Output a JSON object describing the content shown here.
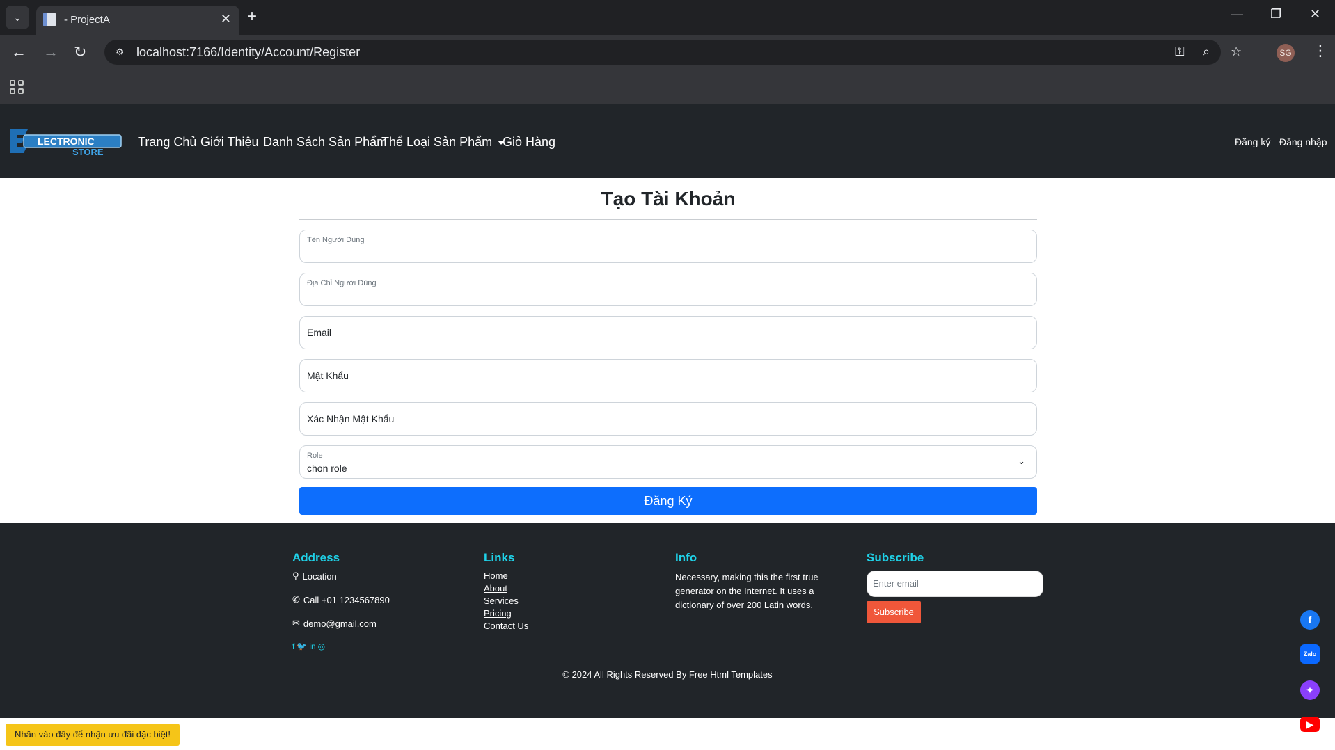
{
  "browser": {
    "tab_title": "- ProjectA",
    "url": "localhost:7166/Identity/Account/Register",
    "profile_initials": "SG"
  },
  "navbar": {
    "logo_text_top": "LECTRONIC",
    "logo_text_bottom": "STORE",
    "links": [
      "Trang Chủ",
      "Giới Thiệu",
      "Danh Sách Sản Phẩm",
      "Thể Loại Sản Phẩm",
      "Giỏ Hàng"
    ],
    "register": "Đăng ký",
    "login": "Đăng nhập"
  },
  "form": {
    "title": "Tạo Tài Khoản",
    "username_label": "Tên Người Dùng",
    "address_label": "Địa Chỉ Người Dùng",
    "email_label": "Email",
    "password_label": "Mật Khẩu",
    "confirm_label": "Xác Nhận Mật Khẩu",
    "role_label": "Role",
    "role_value": "chon role",
    "submit": "Đăng Ký"
  },
  "footer": {
    "address_head": "Address",
    "location": "Location",
    "phone": "Call +01 1234567890",
    "email": "demo@gmail.com",
    "links_head": "Links",
    "links": [
      "Home",
      "About",
      "Services",
      "Pricing",
      "Contact Us"
    ],
    "info_head": "Info",
    "info_text": "Necessary, making this the first true generator on the Internet. It uses a dictionary of over 200 Latin words.",
    "subscribe_head": "Subscribe",
    "subscribe_placeholder": "Enter email",
    "subscribe_button": "Subscribe",
    "copyright": "© 2024 All Rights Reserved By Free Html Templates"
  },
  "promo": "Nhấn vào đây để nhận ưu đãi đặc biệt!",
  "colors": {
    "navbar_bg": "#212529",
    "primary": "#0d6efd",
    "footer_heading": "#1fd2e8",
    "subscribe_btn": "#f0573a",
    "promo_bg": "#f5c518"
  }
}
